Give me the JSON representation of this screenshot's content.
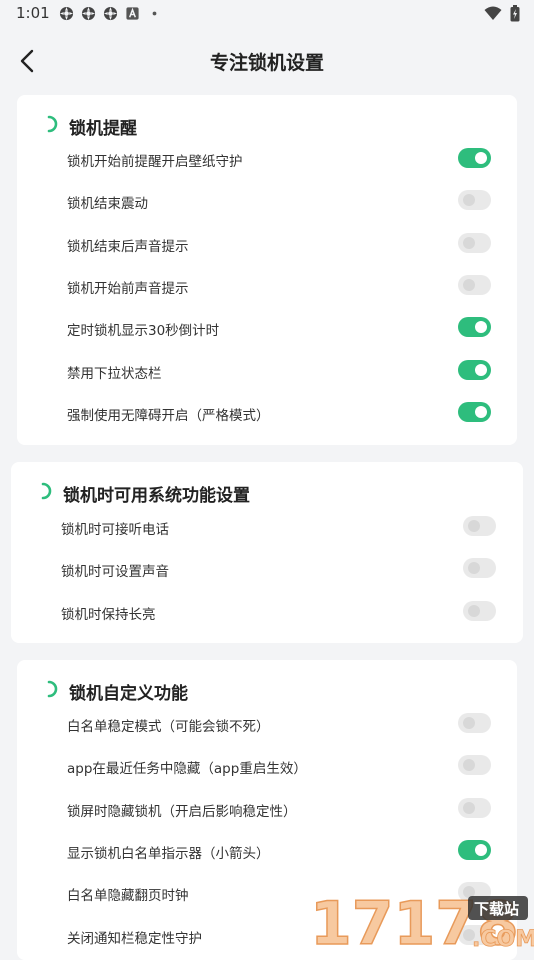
{
  "status": {
    "time": "1:01",
    "notification_icons": [
      "gear-flower-icon",
      "gear-flower-icon",
      "gear-flower-icon",
      "a-box-icon",
      "dot-icon"
    ],
    "right_icons": [
      "wifi-icon",
      "battery-charging-icon"
    ]
  },
  "header": {
    "title": "专注锁机设置"
  },
  "sections": [
    {
      "title": "锁机提醒",
      "items": [
        {
          "label": "锁机开始前提醒开启壁纸守护",
          "on": true
        },
        {
          "label": "锁机结束震动",
          "on": false
        },
        {
          "label": "锁机结束后声音提示",
          "on": false
        },
        {
          "label": "锁机开始前声音提示",
          "on": false
        },
        {
          "label": "定时锁机显示30秒倒计时",
          "on": true
        },
        {
          "label": "禁用下拉状态栏",
          "on": true
        },
        {
          "label": "强制使用无障碍开启（严格模式）",
          "on": true
        }
      ]
    },
    {
      "title": "锁机时可用系统功能设置",
      "items": [
        {
          "label": "锁机时可接听电话",
          "on": false
        },
        {
          "label": "锁机时可设置声音",
          "on": false
        },
        {
          "label": "锁机时保持长亮",
          "on": false
        }
      ]
    },
    {
      "title": "锁机自定义功能",
      "items": [
        {
          "label": "白名单稳定模式（可能会锁不死）",
          "on": false
        },
        {
          "label": "app在最近任务中隐藏（app重启生效）",
          "on": false
        },
        {
          "label": "锁屏时隐藏锁机（开启后影响稳定性）",
          "on": false
        },
        {
          "label": "显示锁机白名单指示器（小箭头）",
          "on": true
        },
        {
          "label": "白名单隐藏翻页时钟",
          "on": false
        },
        {
          "label": "关闭通知栏稳定性守护",
          "on": false
        }
      ]
    }
  ],
  "watermark": {
    "number": "17178",
    "badge": "下载站",
    "domain": ".COM"
  },
  "colors": {
    "accent": "#2ebd7d",
    "toggle_off": "#e9e9e9",
    "background": "#f3f4f6"
  }
}
